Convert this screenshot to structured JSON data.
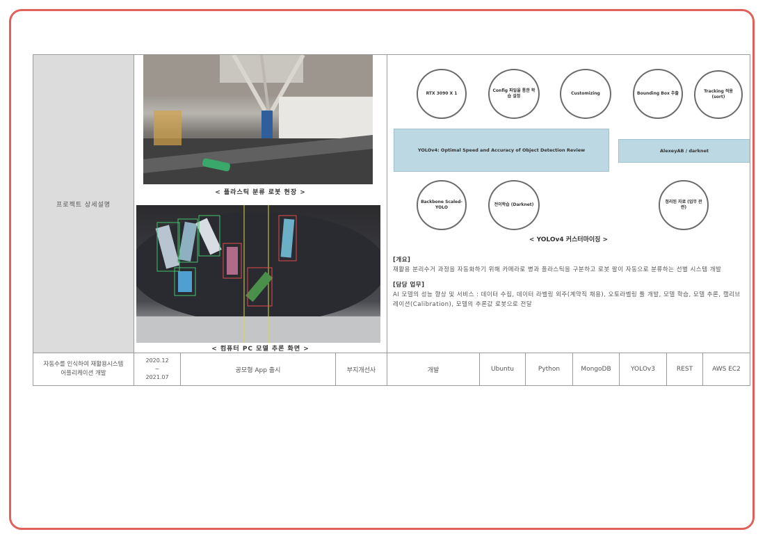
{
  "row1": {
    "label": "프로젝트 상세설명",
    "image1_caption": "< 플라스틱 분류 로봇 현장 >",
    "image2_caption": "< 컴퓨터 PC 모델 추론 화면 >"
  },
  "diagram": {
    "circles": [
      "RTX 3090 X 1",
      "Config 파일을 통한 학습 설정",
      "Customizing",
      "Bounding Box 추출",
      "Tracking 적용 (sort)",
      "Backbone Scaled-YOLO",
      "전이학습 (Darknet)",
      "정리된 자료 (업무 관련)"
    ],
    "box_main": "YOLOv4: Optimal Speed and Accuracy of Object Detection Review",
    "box_side": "AlexeyAB / darknet",
    "caption": "< YOLOv4 커스터마이징 >"
  },
  "description": {
    "overview_title": "[개요]",
    "overview_text": "재활용 분리수거 과정을 자동화하기 위해 카메라로 병과 플라스틱을 구분하고 로봇 팔이 자동으로 분류하는 선별 시스템 개발",
    "duty_title": "[담당 업무]",
    "duty_text": "AI 모델의 성능 향상 및 서비스 : 데이터 수집, 데이터 라벨링 외주(계약직 채용), 오토라벨링 툴 개발, 모델 학습, 모델 추론, 캘리브레이션(Calibration), 모델의 추론값 로봇으로 전달"
  },
  "row2": {
    "project": "자동수를 인식하여 재활용시스템 어플리케이션 개발",
    "period": "2020.12\n~\n2021.07",
    "name": "공모형 App 출시",
    "company": "부지개선사",
    "role": "개발",
    "tech": [
      "Ubuntu",
      "Python",
      "MongoDB",
      "YOLOv3",
      "REST",
      "AWS EC2"
    ]
  }
}
